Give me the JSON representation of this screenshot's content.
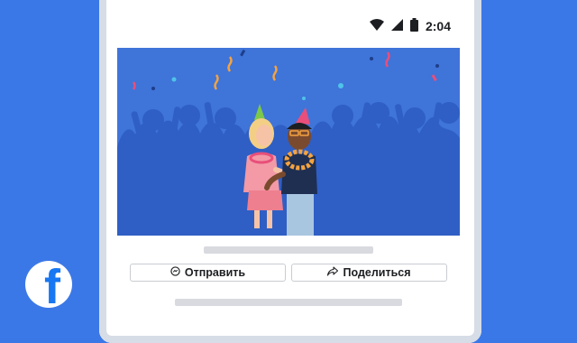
{
  "status_bar": {
    "time": "2:04",
    "icons": [
      "wifi-icon",
      "signal-icon",
      "battery-icon"
    ]
  },
  "post": {
    "actions": [
      {
        "label": "Отправить",
        "icon": "messenger-icon"
      },
      {
        "label": "Поделиться",
        "icon": "share-icon"
      }
    ]
  },
  "brand": {
    "logo_letter": "f",
    "logo_color": "#1877f2",
    "background_color": "#3b78e7"
  }
}
